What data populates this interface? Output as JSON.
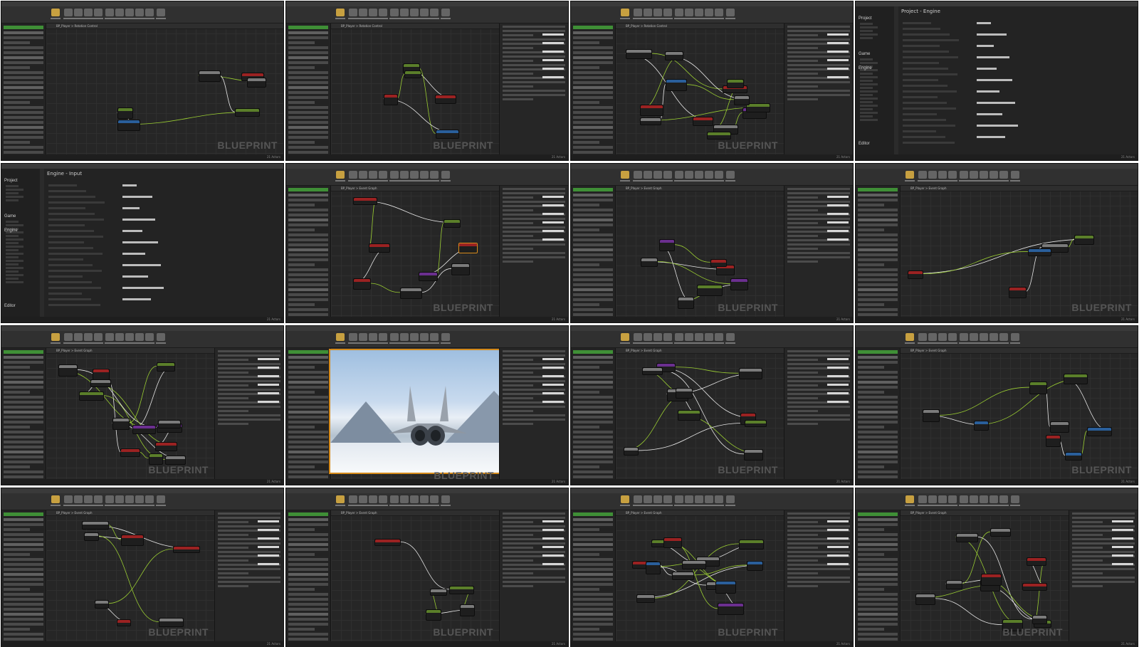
{
  "tiles": [
    {
      "id": 1,
      "type": "blueprint-graph",
      "breadcrumb": "BP_Player > Rotation Control",
      "watermark": "BLUEPRINT",
      "status": "21 Actors",
      "has_details": false
    },
    {
      "id": 2,
      "type": "blueprint-graph",
      "breadcrumb": "BP_Player > Rotation Control",
      "watermark": "BLUEPRINT",
      "status": "21 Actors",
      "has_details": true
    },
    {
      "id": 3,
      "type": "blueprint-graph",
      "breadcrumb": "BP_Player > Rotation Control",
      "watermark": "BLUEPRINT",
      "status": "21 Actors",
      "has_details": true
    },
    {
      "id": 4,
      "type": "project-settings",
      "title": "Project - Engine",
      "sections": [
        "Project",
        "Game",
        "Engine",
        "Editor"
      ],
      "status": "21 Actors"
    },
    {
      "id": 5,
      "type": "project-settings",
      "title": "Engine - Input",
      "sections": [
        "Project",
        "Game",
        "Engine",
        "Editor"
      ],
      "status": "21 Actors"
    },
    {
      "id": 6,
      "type": "blueprint-graph",
      "breadcrumb": "BP_Player > Event Graph",
      "watermark": "BLUEPRINT",
      "status": "21 Actors",
      "has_details": true
    },
    {
      "id": 7,
      "type": "blueprint-graph",
      "breadcrumb": "BP_Player > Event Graph",
      "watermark": "BLUEPRINT",
      "status": "21 Actors",
      "has_details": true
    },
    {
      "id": 8,
      "type": "blueprint-graph",
      "breadcrumb": "BP_Player > Event Graph",
      "watermark": "BLUEPRINT",
      "status": "21 Actors",
      "has_details": false
    },
    {
      "id": 9,
      "type": "blueprint-graph",
      "breadcrumb": "BP_Player > Event Graph",
      "watermark": "BLUEPRINT",
      "status": "21 Actors",
      "has_details": true
    },
    {
      "id": 10,
      "type": "game-preview",
      "watermark": "BLUEPRINT",
      "status": "21 Actors"
    },
    {
      "id": 11,
      "type": "blueprint-graph",
      "breadcrumb": "BP_Player > Event Graph",
      "watermark": "BLUEPRINT",
      "status": "21 Actors",
      "has_details": true
    },
    {
      "id": 12,
      "type": "blueprint-graph",
      "breadcrumb": "BP_Player > Event Graph",
      "watermark": "BLUEPRINT",
      "status": "21 Actors",
      "has_details": false
    },
    {
      "id": 13,
      "type": "blueprint-graph",
      "breadcrumb": "BP_Player > Event Graph",
      "watermark": "BLUEPRINT",
      "status": "21 Actors",
      "has_details": true
    },
    {
      "id": 14,
      "type": "blueprint-graph",
      "breadcrumb": "BP_Player > Event Graph",
      "watermark": "BLUEPRINT",
      "status": "21 Actors",
      "has_details": true
    },
    {
      "id": 15,
      "type": "blueprint-graph",
      "breadcrumb": "BP_Player > Event Graph",
      "watermark": "BLUEPRINT",
      "status": "21 Actors",
      "has_details": true
    },
    {
      "id": 16,
      "type": "blueprint-graph",
      "breadcrumb": "BP_Player > Event Graph",
      "watermark": "BLUEPRINT",
      "status": "21 Actors",
      "has_details": true
    }
  ],
  "colors": {
    "accent_orange": "#d58a1a",
    "exec_wire": "#e6e6e6",
    "data_wire": "#9acd32",
    "event_node": "#9b2222"
  }
}
